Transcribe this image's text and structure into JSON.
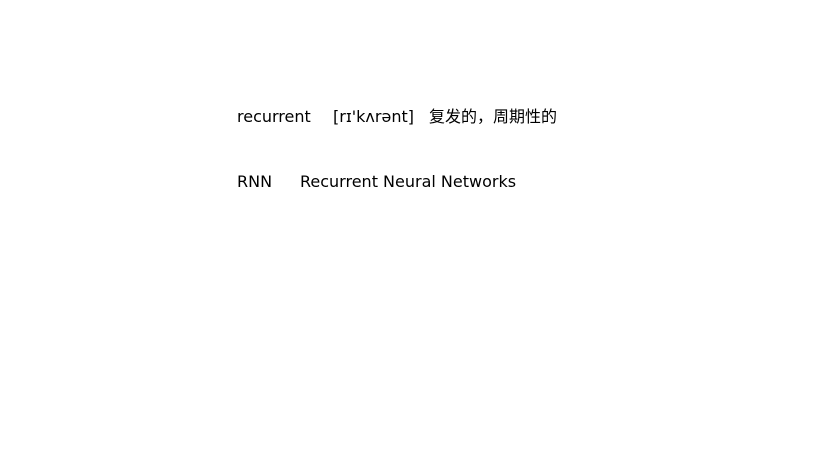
{
  "entries": [
    {
      "term": "recurrent",
      "phonetic": "[rɪ'kʌrənt]",
      "meaning": "复发的，周期性的"
    },
    {
      "term": "RNN",
      "meaning": "Recurrent Neural Networks"
    }
  ]
}
